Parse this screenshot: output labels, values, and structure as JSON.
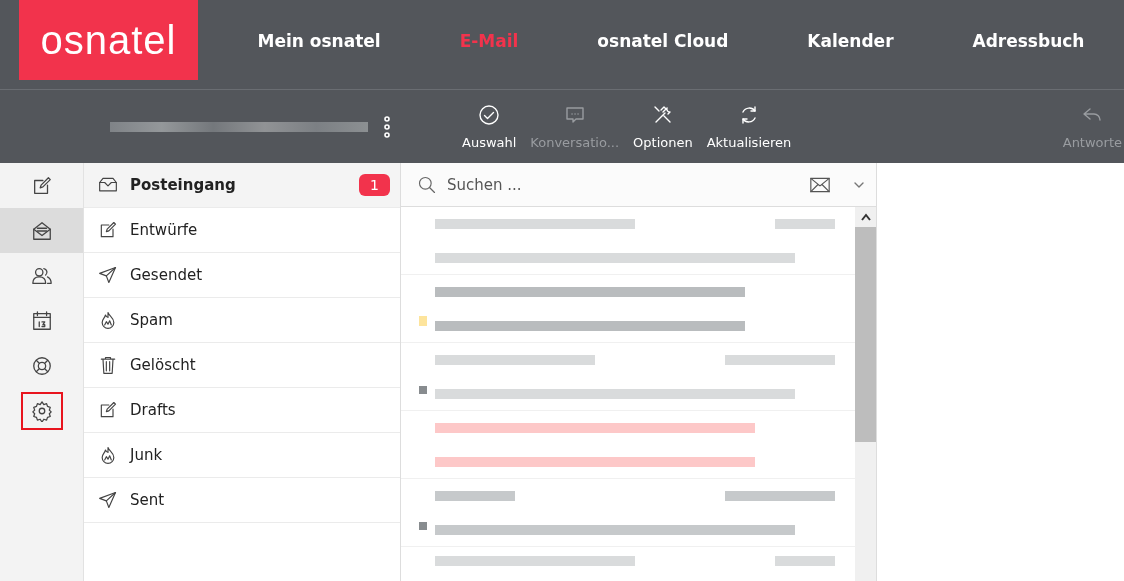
{
  "logo": "osnatel",
  "nav": [
    {
      "label": "Mein osnatel",
      "selected": false
    },
    {
      "label": "E-Mail",
      "selected": true
    },
    {
      "label": "osnatel Cloud",
      "selected": false
    },
    {
      "label": "Kalender",
      "selected": false
    },
    {
      "label": "Adressbuch",
      "selected": false
    }
  ],
  "toolbar": [
    {
      "kind": "check",
      "label": "Auswahl",
      "disabled": false
    },
    {
      "kind": "chat",
      "label": "Konversatio...",
      "disabled": true
    },
    {
      "kind": "tools",
      "label": "Optionen",
      "disabled": false
    },
    {
      "kind": "refresh",
      "label": "Aktualisieren",
      "disabled": false
    },
    {
      "kind": "reply",
      "label": "Antworte",
      "disabled": true
    }
  ],
  "rail": [
    {
      "kind": "compose",
      "selected": false,
      "highlighted": false
    },
    {
      "kind": "mail",
      "selected": true,
      "highlighted": false
    },
    {
      "kind": "contacts",
      "selected": false,
      "highlighted": false
    },
    {
      "kind": "calendar",
      "selected": false,
      "highlighted": false
    },
    {
      "kind": "help",
      "selected": false,
      "highlighted": false
    },
    {
      "kind": "settings",
      "selected": false,
      "highlighted": true
    }
  ],
  "folders": [
    {
      "kind": "inbox",
      "label": "Posteingang",
      "selected": true,
      "badge": "1"
    },
    {
      "kind": "draft",
      "label": "Entwürfe",
      "selected": false
    },
    {
      "kind": "sent",
      "label": "Gesendet",
      "selected": false
    },
    {
      "kind": "spam",
      "label": "Spam",
      "selected": false
    },
    {
      "kind": "trash",
      "label": "Gelöscht",
      "selected": false
    },
    {
      "kind": "draft",
      "label": "Drafts",
      "selected": false
    },
    {
      "kind": "spam",
      "label": "Junk",
      "selected": false
    },
    {
      "kind": "sent",
      "label": "Sent",
      "selected": false
    }
  ],
  "search": {
    "placeholder": "Suchen ..."
  },
  "messages": [
    {
      "flagged": false,
      "unread": false,
      "color": "#d9dbdc"
    },
    {
      "flagged": true,
      "unread": false,
      "color": "#b9bcbe"
    },
    {
      "flagged": false,
      "unread": true,
      "color": "#d9dbdc"
    },
    {
      "flagged": false,
      "unread": false,
      "color": "#fdc8c8"
    },
    {
      "flagged": false,
      "unread": true,
      "color": "#c6c9cb"
    },
    {
      "color": "#d9dbdc"
    }
  ]
}
